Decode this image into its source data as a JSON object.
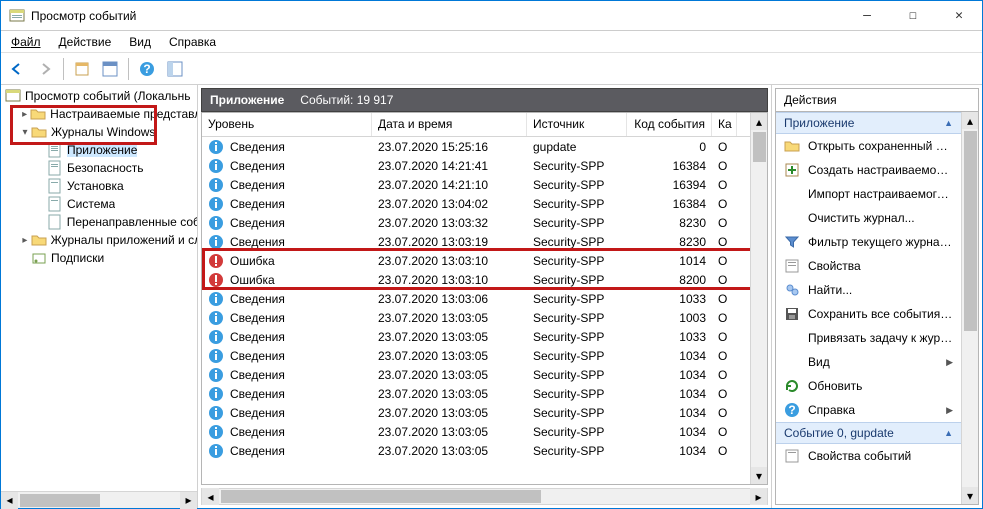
{
  "window": {
    "title": "Просмотр событий",
    "min": "—",
    "max": "☐",
    "close": "✕"
  },
  "menu": {
    "file": "Файл",
    "action": "Действие",
    "view": "Вид",
    "help": "Справка"
  },
  "tree": {
    "root": "Просмотр событий (Локальнь",
    "custom_views": "Настраиваемые представле",
    "win_logs": "Журналы Windows",
    "app": "Приложение",
    "security": "Безопасность",
    "setup": "Установка",
    "system": "Система",
    "forwarded": "Перенаправленные соб",
    "app_services": "Журналы приложений и сл",
    "subscriptions": "Подписки"
  },
  "center": {
    "title": "Приложение",
    "count_label": "Событий: 19 917",
    "columns": {
      "level": "Уровень",
      "date": "Дата и время",
      "source": "Источник",
      "code": "Код события",
      "category": "Ка"
    },
    "rows": [
      {
        "level": "Сведения",
        "date": "23.07.2020 15:25:16",
        "src": "gupdate",
        "code": "0",
        "cat": "О",
        "err": false
      },
      {
        "level": "Сведения",
        "date": "23.07.2020 14:21:41",
        "src": "Security-SPP",
        "code": "16384",
        "cat": "О",
        "err": false
      },
      {
        "level": "Сведения",
        "date": "23.07.2020 14:21:10",
        "src": "Security-SPP",
        "code": "16394",
        "cat": "О",
        "err": false
      },
      {
        "level": "Сведения",
        "date": "23.07.2020 13:04:02",
        "src": "Security-SPP",
        "code": "16384",
        "cat": "О",
        "err": false
      },
      {
        "level": "Сведения",
        "date": "23.07.2020 13:03:32",
        "src": "Security-SPP",
        "code": "8230",
        "cat": "О",
        "err": false
      },
      {
        "level": "Сведения",
        "date": "23.07.2020 13:03:19",
        "src": "Security-SPP",
        "code": "8230",
        "cat": "О",
        "err": false
      },
      {
        "level": "Ошибка",
        "date": "23.07.2020 13:03:10",
        "src": "Security-SPP",
        "code": "1014",
        "cat": "О",
        "err": true
      },
      {
        "level": "Ошибка",
        "date": "23.07.2020 13:03:10",
        "src": "Security-SPP",
        "code": "8200",
        "cat": "О",
        "err": true
      },
      {
        "level": "Сведения",
        "date": "23.07.2020 13:03:06",
        "src": "Security-SPP",
        "code": "1033",
        "cat": "О",
        "err": false
      },
      {
        "level": "Сведения",
        "date": "23.07.2020 13:03:05",
        "src": "Security-SPP",
        "code": "1003",
        "cat": "О",
        "err": false
      },
      {
        "level": "Сведения",
        "date": "23.07.2020 13:03:05",
        "src": "Security-SPP",
        "code": "1033",
        "cat": "О",
        "err": false
      },
      {
        "level": "Сведения",
        "date": "23.07.2020 13:03:05",
        "src": "Security-SPP",
        "code": "1034",
        "cat": "О",
        "err": false
      },
      {
        "level": "Сведения",
        "date": "23.07.2020 13:03:05",
        "src": "Security-SPP",
        "code": "1034",
        "cat": "О",
        "err": false
      },
      {
        "level": "Сведения",
        "date": "23.07.2020 13:03:05",
        "src": "Security-SPP",
        "code": "1034",
        "cat": "О",
        "err": false
      },
      {
        "level": "Сведения",
        "date": "23.07.2020 13:03:05",
        "src": "Security-SPP",
        "code": "1034",
        "cat": "О",
        "err": false
      },
      {
        "level": "Сведения",
        "date": "23.07.2020 13:03:05",
        "src": "Security-SPP",
        "code": "1034",
        "cat": "О",
        "err": false
      },
      {
        "level": "Сведения",
        "date": "23.07.2020 13:03:05",
        "src": "Security-SPP",
        "code": "1034",
        "cat": "О",
        "err": false
      }
    ]
  },
  "actions": {
    "pane_title": "Действия",
    "section1": "Приложение",
    "open_saved": "Открыть сохраненный ж...",
    "create_custom": "Создать настраиваемое п...",
    "import_custom": "Импорт настраиваемого...",
    "clear_log": "Очистить журнал...",
    "filter_current": "Фильтр текущего журнал...",
    "properties": "Свойства",
    "find": "Найти...",
    "save_all": "Сохранить все события к...",
    "attach_task": "Привязать задачу к журн...",
    "view": "Вид",
    "refresh": "Обновить",
    "help": "Справка",
    "section2": "Событие 0, gupdate",
    "event_props": "Свойства событий"
  }
}
